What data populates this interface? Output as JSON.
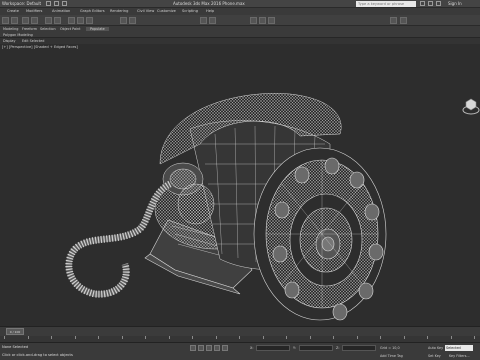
{
  "titlebar": {
    "workspace": "Workspace: Default",
    "title": "Autodesk 3ds Max 2016    Phone.max",
    "search_placeholder": "Type a keyword or phrase",
    "sign_in": "Sign In"
  },
  "menu": {
    "items": [
      "Create",
      "Modifiers",
      "Animation",
      "Graph Editors",
      "Rendering",
      "Civil View",
      "Customize",
      "Scripting",
      "Help"
    ]
  },
  "ribbon": {
    "tabs": [
      "Modeling",
      "Freeform",
      "Selection",
      "Object Paint",
      "Populate"
    ],
    "subrow": [
      "Polygon Modeling"
    ],
    "filters": [
      "Display",
      "Edit Selected"
    ]
  },
  "viewport": {
    "label": "[+] [Perspective] [Shaded + Edged Faces]"
  },
  "timeline": {
    "slider_label": "0 / 100"
  },
  "statusbar": {
    "selection_count": "None Selected",
    "prompt": "Click or click-and-drag to select objects",
    "x_label": "X:",
    "y_label": "Y:",
    "z_label": "Z:",
    "grid": "Grid = 10,0",
    "add_time_tag": "Add Time Tag",
    "auto_key": "Auto Key",
    "set_key": "Set Key",
    "key_filters": "Key Filters...",
    "selected": "Selected"
  },
  "colors": {
    "wire": "#d9d9d9",
    "viewport_bg": "#2d2d2d"
  }
}
